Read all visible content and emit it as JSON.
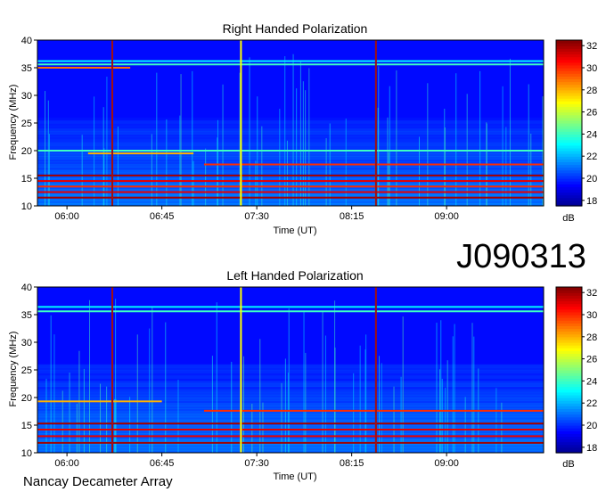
{
  "observation_id": "J090313",
  "instrument": "Nancay Decameter Array",
  "colors": {
    "colormap": [
      "#00008f",
      "#0000ff",
      "#0080ff",
      "#00ffff",
      "#80ff80",
      "#ffff00",
      "#ff8000",
      "#ff0000",
      "#800000"
    ],
    "vertical_artifact_yellow": "#ffff00",
    "vertical_artifact_red": "#a01010"
  },
  "chart_data": [
    {
      "type": "heatmap",
      "title": "Right Handed Polarization",
      "xlabel": "Time (UT)",
      "ylabel": "Frequency (MHz)",
      "x_ticks": [
        "06:00",
        "06:45",
        "07:30",
        "08:15",
        "09:00"
      ],
      "x_tick_minutes": [
        360,
        405,
        450,
        495,
        540
      ],
      "xlim_minutes": [
        346,
        586
      ],
      "y_ticks": [
        "10",
        "15",
        "20",
        "25",
        "30",
        "35",
        "40"
      ],
      "ylim": [
        10,
        40
      ],
      "colorbar": {
        "label": "dB",
        "ticks": [
          "18",
          "20",
          "22",
          "24",
          "26",
          "28",
          "30",
          "32"
        ],
        "range": [
          17.5,
          32.5
        ]
      },
      "background_level_db": 19.5,
      "vertical_artifacts": [
        {
          "time_minutes": 381.5,
          "level_db": 31,
          "color": "red"
        },
        {
          "time_minutes": 442.5,
          "level_db": 27,
          "color": "yellow"
        },
        {
          "time_minutes": 506.5,
          "level_db": 31,
          "color": "red"
        }
      ],
      "horizontal_bands": [
        {
          "freq_mhz": 36.2,
          "level_db": 23,
          "t_start": 346,
          "t_end": 586
        },
        {
          "freq_mhz": 35.6,
          "level_db": 24,
          "t_start": 346,
          "t_end": 586
        },
        {
          "freq_mhz": 35.0,
          "level_db": 29,
          "t_start": 346,
          "t_end": 390
        },
        {
          "freq_mhz": 20.0,
          "level_db": 24,
          "t_start": 346,
          "t_end": 586
        },
        {
          "freq_mhz": 19.5,
          "level_db": 28,
          "t_start": 370,
          "t_end": 420
        },
        {
          "freq_mhz": 17.5,
          "level_db": 30,
          "t_start": 425,
          "t_end": 586
        },
        {
          "freq_mhz": 15.5,
          "level_db": 32,
          "t_start": 346,
          "t_end": 586
        },
        {
          "freq_mhz": 14.5,
          "level_db": 31,
          "t_start": 346,
          "t_end": 586
        },
        {
          "freq_mhz": 13.5,
          "level_db": 30,
          "t_start": 346,
          "t_end": 586
        },
        {
          "freq_mhz": 12.5,
          "level_db": 31,
          "t_start": 346,
          "t_end": 586
        },
        {
          "freq_mhz": 11.5,
          "level_db": 32,
          "t_start": 346,
          "t_end": 586
        }
      ]
    },
    {
      "type": "heatmap",
      "title": "Left Handed Polarization",
      "xlabel": "Time (UT)",
      "ylabel": "Frequency (MHz)",
      "x_ticks": [
        "06:00",
        "06:45",
        "07:30",
        "08:15",
        "09:00"
      ],
      "x_tick_minutes": [
        360,
        405,
        450,
        495,
        540
      ],
      "xlim_minutes": [
        346,
        586
      ],
      "y_ticks": [
        "10",
        "15",
        "20",
        "25",
        "30",
        "35",
        "40"
      ],
      "ylim": [
        10,
        40
      ],
      "colorbar": {
        "label": "dB",
        "ticks": [
          "18",
          "20",
          "22",
          "24",
          "26",
          "28",
          "30",
          "32"
        ],
        "range": [
          17.5,
          32.5
        ]
      },
      "background_level_db": 19.5,
      "vertical_artifacts": [
        {
          "time_minutes": 381.5,
          "level_db": 31,
          "color": "red"
        },
        {
          "time_minutes": 442.5,
          "level_db": 27,
          "color": "yellow"
        },
        {
          "time_minutes": 506.5,
          "level_db": 31,
          "color": "red"
        }
      ],
      "horizontal_bands": [
        {
          "freq_mhz": 36.4,
          "level_db": 23,
          "t_start": 346,
          "t_end": 586
        },
        {
          "freq_mhz": 35.6,
          "level_db": 24,
          "t_start": 346,
          "t_end": 586
        },
        {
          "freq_mhz": 19.3,
          "level_db": 28,
          "t_start": 346,
          "t_end": 405
        },
        {
          "freq_mhz": 17.6,
          "level_db": 30,
          "t_start": 425,
          "t_end": 586
        },
        {
          "freq_mhz": 15.3,
          "level_db": 32,
          "t_start": 346,
          "t_end": 586
        },
        {
          "freq_mhz": 14.2,
          "level_db": 31,
          "t_start": 346,
          "t_end": 586
        },
        {
          "freq_mhz": 13.0,
          "level_db": 31,
          "t_start": 346,
          "t_end": 586
        },
        {
          "freq_mhz": 11.8,
          "level_db": 32,
          "t_start": 346,
          "t_end": 586
        }
      ]
    }
  ]
}
